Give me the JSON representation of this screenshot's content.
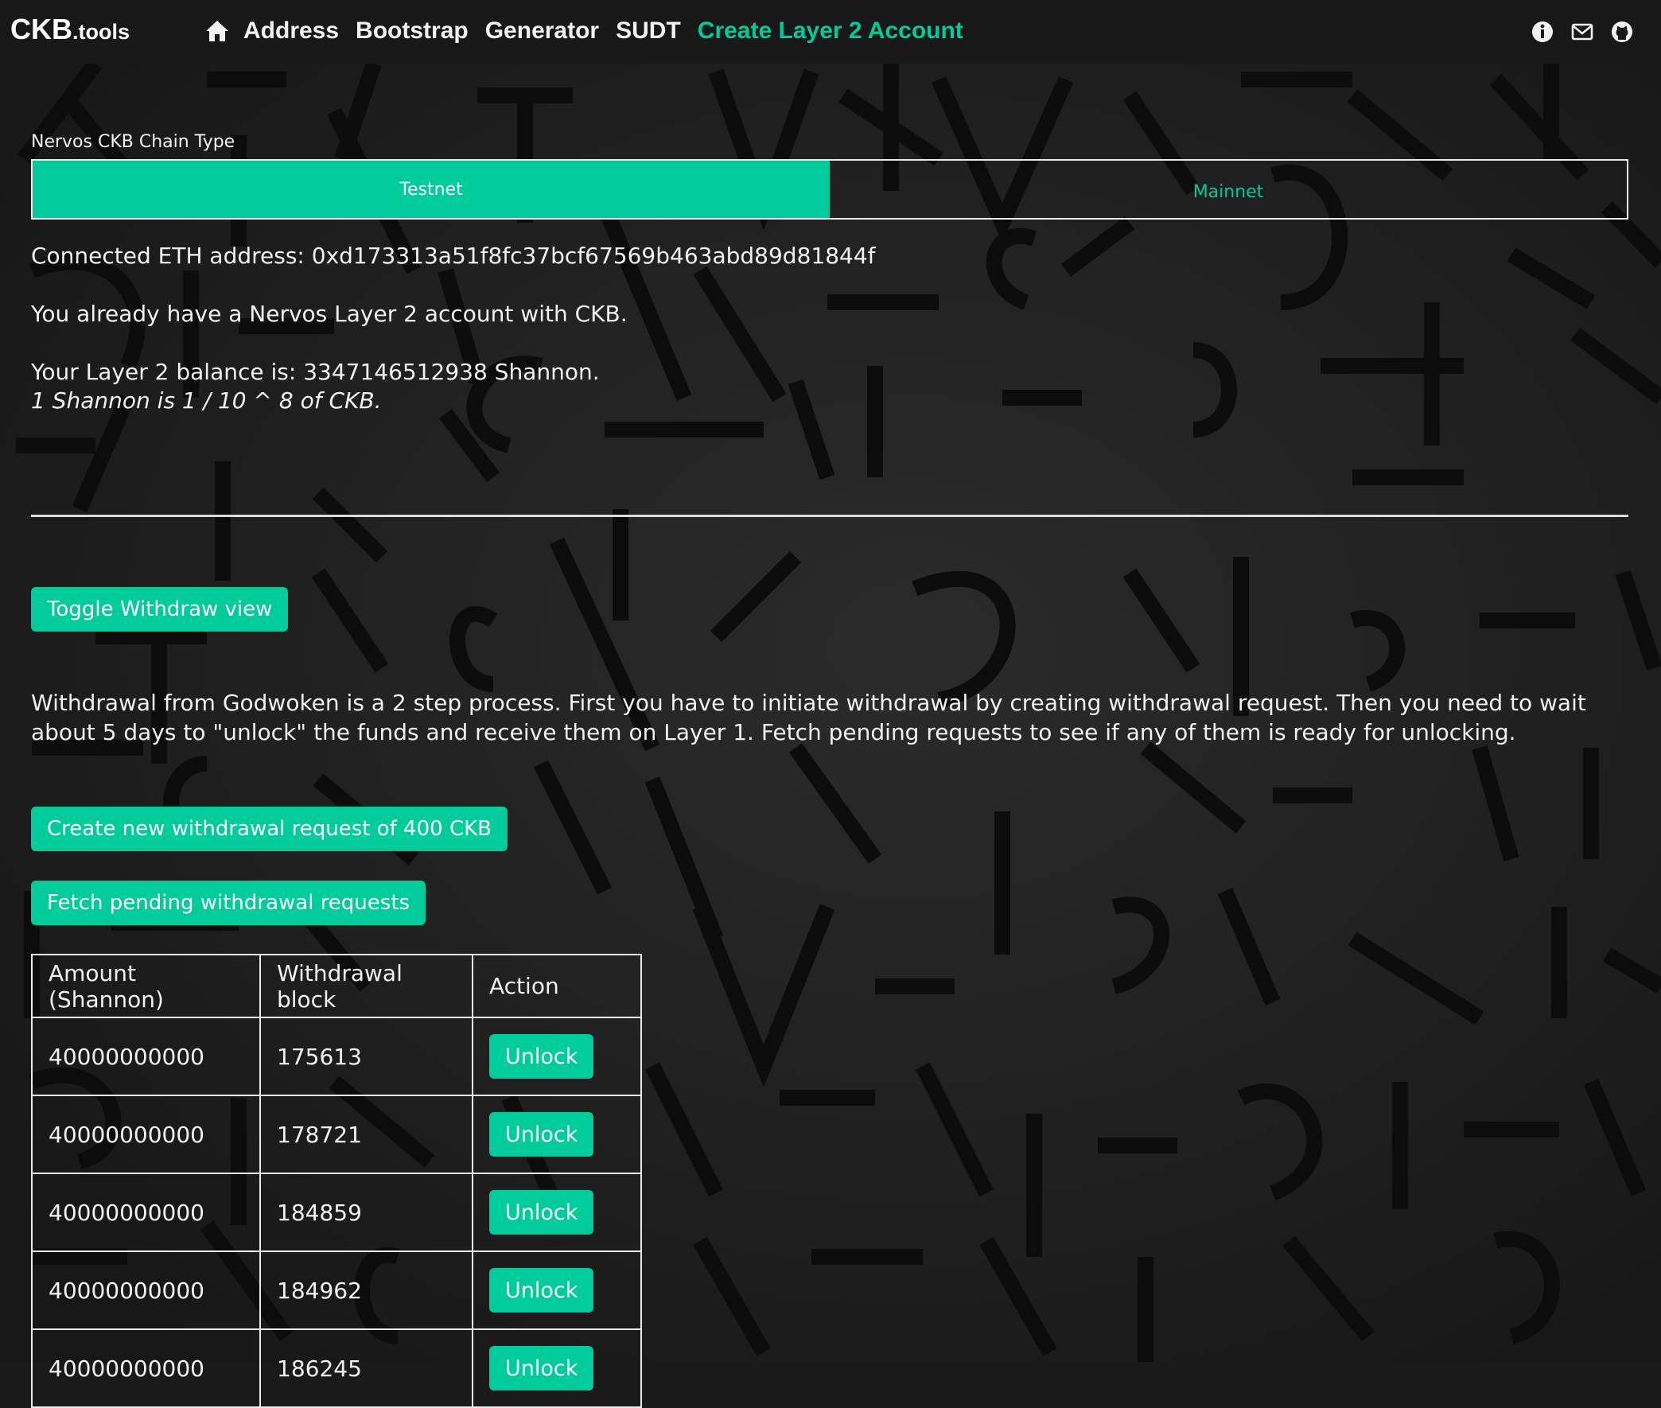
{
  "brand": {
    "ckb": "CKB",
    "tools": ".tools"
  },
  "nav": {
    "home_icon": "home-icon",
    "items": [
      "Address",
      "Bootstrap",
      "Generator",
      "SUDT",
      "Create Layer 2 Account"
    ],
    "active": "Create Layer 2 Account"
  },
  "header_icons": [
    "info-icon",
    "envelope-icon",
    "github-icon"
  ],
  "chain": {
    "label": "Nervos CKB Chain Type",
    "options": [
      "Testnet",
      "Mainnet"
    ],
    "selected": "Testnet"
  },
  "account": {
    "connected": "Connected ETH address: 0xd173313a51f8fc37bcf67569b463abd89d81844f",
    "status": "You already have a Nervos Layer 2 account with CKB.",
    "balance": "Your Layer 2 balance is: 3347146512938 Shannon.",
    "note": "1 Shannon is 1 / 10 ^ 8 of CKB."
  },
  "withdraw": {
    "toggle_label": "Toggle Withdraw view",
    "description": "Withdrawal from Godwoken is a 2 step process. First you have to initiate withdrawal by creating withdrawal request. Then you need to wait about 5 days to \"unlock\" the funds and receive them on Layer 1. Fetch pending requests to see if any of them is ready for unlocking.",
    "create_label": "Create new withdrawal request of 400 CKB",
    "fetch_label": "Fetch pending withdrawal requests"
  },
  "table": {
    "headers": [
      "Amount (Shannon)",
      "Withdrawal block",
      "Action"
    ],
    "rows": [
      {
        "amount": "40000000000",
        "block": "175613",
        "action": "Unlock"
      },
      {
        "amount": "40000000000",
        "block": "178721",
        "action": "Unlock"
      },
      {
        "amount": "40000000000",
        "block": "184859",
        "action": "Unlock"
      },
      {
        "amount": "40000000000",
        "block": "184962",
        "action": "Unlock"
      },
      {
        "amount": "40000000000",
        "block": "186245",
        "action": "Unlock"
      }
    ]
  },
  "colors": {
    "accent": "#00cc9b",
    "background": "#1a1a1a",
    "header": "#181818"
  }
}
